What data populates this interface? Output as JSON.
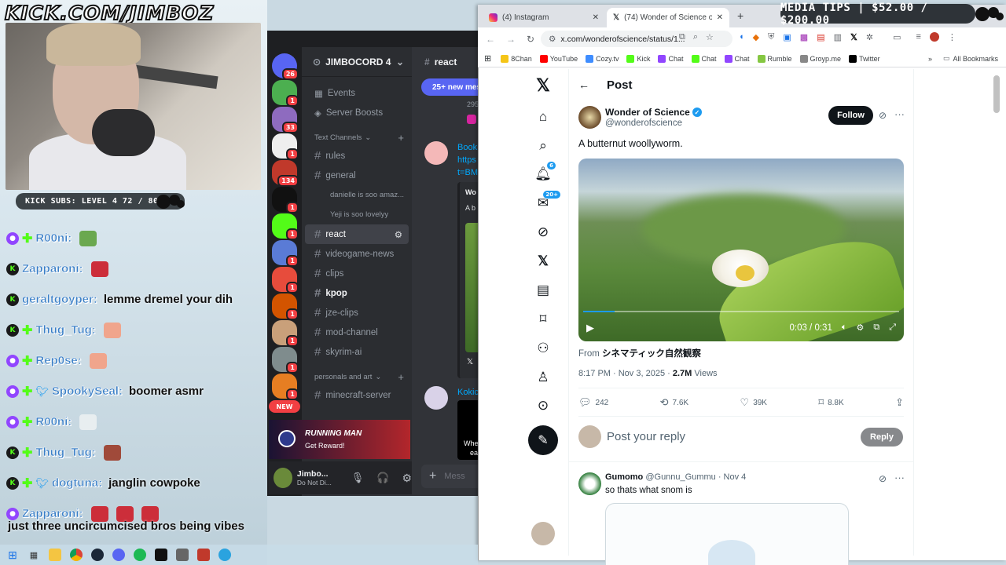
{
  "overlay": {
    "brand": "KICK.COM/JIMBOZ",
    "subs_bar": "KICK SUBS: LEVEL 4 72 / 80",
    "media_tips": "MEDIA TIPS | $52.00 / $200.00",
    "chat": [
      {
        "platform": "twitch",
        "badges": [
          "plus"
        ],
        "name": "R00ni:",
        "msg": "",
        "emotes": [
          "#6aa84f"
        ]
      },
      {
        "platform": "kick",
        "badges": [],
        "name": "Zapparoni:",
        "msg": "",
        "emotes": [
          "#cc2e3a"
        ]
      },
      {
        "platform": "kick",
        "badges": [],
        "name": "geraltgoyper:",
        "msg": "lemme dremel your dih",
        "emotes": []
      },
      {
        "platform": "kick",
        "badges": [
          "plus"
        ],
        "name": "Thug_Tug:",
        "msg": "",
        "emotes": [
          "#f0a58c"
        ]
      },
      {
        "platform": "twitch",
        "badges": [
          "plus"
        ],
        "name": "Rep0se:",
        "msg": "",
        "emotes": [
          "#f0a58c"
        ]
      },
      {
        "platform": "twitch",
        "badges": [
          "plus",
          "bird"
        ],
        "name": "SpookySeal:",
        "msg": "boomer asmr",
        "emotes": []
      },
      {
        "platform": "twitch",
        "badges": [
          "plus"
        ],
        "name": "R00ni:",
        "msg": "",
        "emotes": [
          "#e8eef0"
        ]
      },
      {
        "platform": "kick",
        "badges": [
          "plus"
        ],
        "name": "Thug_Tug:",
        "msg": "",
        "emotes": [
          "#a04a3a"
        ]
      },
      {
        "platform": "kick",
        "badges": [
          "plus",
          "bird"
        ],
        "name": "dogtuna:",
        "msg": "janglin cowpoke",
        "emotes": []
      },
      {
        "platform": "twitch",
        "badges": [],
        "name": "Zapparoni:",
        "msg": "",
        "emotes": [
          "#cc2e3a",
          "#cc2e3a",
          "#cc2e3a"
        ]
      }
    ],
    "last_msg": "just three uncircumcised bros being vibes"
  },
  "discord": {
    "server": "JIMBOCORD 4",
    "channel_header": "react",
    "new_messages": "25+ new mes",
    "guild_badges": [
      "26",
      "1",
      "33",
      "1",
      "134",
      "1",
      "1",
      "1",
      "1",
      "1",
      "1",
      "1",
      "1"
    ],
    "new_label": "NEW",
    "channels_top": [
      "Events",
      "Server Boosts"
    ],
    "category1": "Text Channels",
    "channels": [
      {
        "name": "rules",
        "style": "normal"
      },
      {
        "name": "general",
        "style": "normal"
      }
    ],
    "threads": [
      "danielle is soo amaz...",
      "Yeji is soo lovelyy"
    ],
    "channels2": [
      {
        "name": "react",
        "style": "active"
      },
      {
        "name": "videogame-news",
        "style": "normal"
      },
      {
        "name": "clips",
        "style": "normal"
      },
      {
        "name": "kpop",
        "style": "bold"
      },
      {
        "name": "jze-clips",
        "style": "normal"
      },
      {
        "name": "mod-channel",
        "style": "normal"
      },
      {
        "name": "skyrim-ai",
        "style": "normal"
      }
    ],
    "category2": "personals and art",
    "channels3": [
      {
        "name": "minecraft-server",
        "style": "normal"
      }
    ],
    "promo_title": "RUNNING MAN",
    "promo_sub": "Get Reward!",
    "user_name": "Jimbo...",
    "user_status": "Do Not Di...",
    "msg_snippets": [
      "295",
      "Book",
      "https",
      "t=BM",
      "Wo",
      "A b",
      "Kokic",
      "Whe",
      "ea"
    ],
    "message_placeholder": "Mess"
  },
  "browser": {
    "tabs": [
      {
        "title": "(4) Instagram",
        "active": false
      },
      {
        "title": "(74) Wonder of Science on X: \"A",
        "active": true
      }
    ],
    "url": "x.com/wonderofscience/status/1...",
    "bookmarks": [
      "8Chan",
      "YouTube",
      "Cozy.tv",
      "Kick",
      "Chat",
      "Chat",
      "Chat",
      "Rumble",
      "Groyp.me",
      "Twitter"
    ],
    "bookmark_colors": [
      "#f5c518",
      "#ff0000",
      "#3f8dff",
      "#53fc18",
      "#9146ff",
      "#53fc18",
      "#9146ff",
      "#85c742",
      "#888888",
      "#000000"
    ],
    "all_bookmarks": "All Bookmarks"
  },
  "x": {
    "nav_badges": {
      "notifications": "6",
      "messages": "20+"
    },
    "page_title": "Post",
    "author_name": "Wonder of Science",
    "author_handle": "@wonderofscience",
    "follow_label": "Follow",
    "post_text": "A butternut woollyworm.",
    "video_time": "0:03 / 0:31",
    "video_progress": 0.1,
    "from_prefix": "From",
    "from_source": "シネマティック自然観察",
    "timestamp": "8:17 PM · Nov 3, 2025 · ",
    "views_count": "2.7M",
    "views_label": "Views",
    "replies": "242",
    "reposts": "7.6K",
    "likes": "39K",
    "bookmarks": "8.8K",
    "reply_placeholder": "Post your reply",
    "reply_button": "Reply",
    "reply_author": "Gumomo",
    "reply_handle": "@Gunnu_Gummu · Nov 4",
    "reply_text": "so thats what snom is",
    "accent": "#1d9bf0"
  }
}
